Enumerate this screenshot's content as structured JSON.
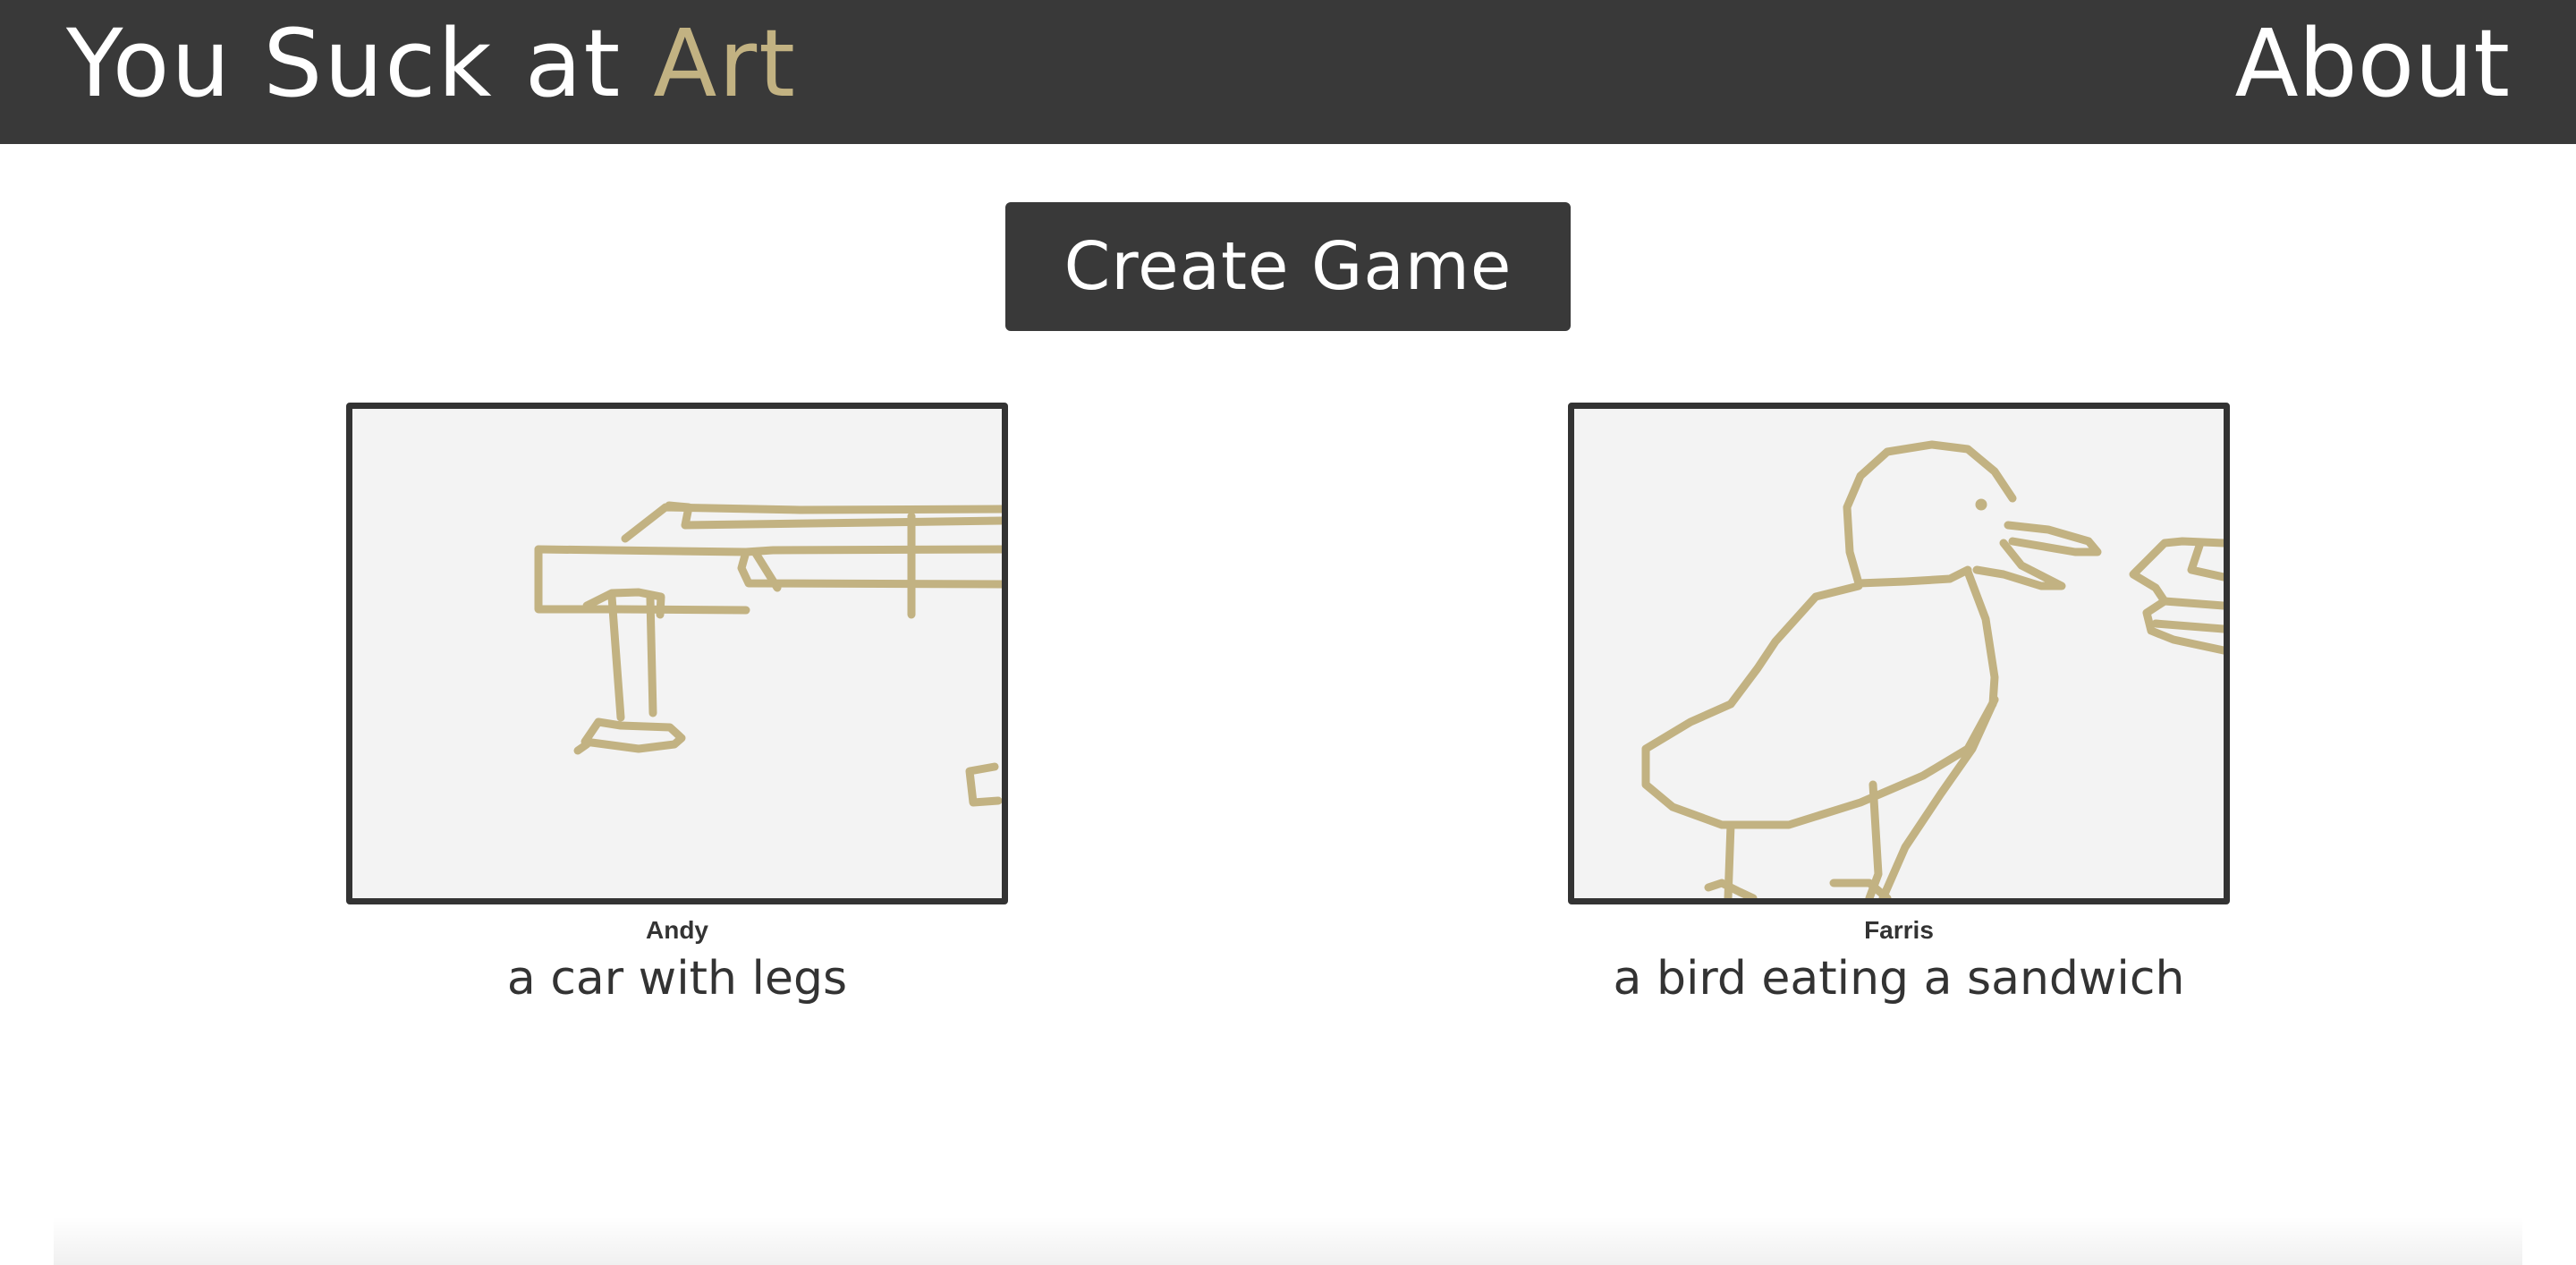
{
  "header": {
    "brand_prefix": "You Suck at ",
    "brand_accent": "Art",
    "about_label": "About"
  },
  "actions": {
    "create_game_label": "Create Game"
  },
  "colors": {
    "header_bg": "#393939",
    "accent": "#c2b282",
    "drawing_stroke": "#c2b282",
    "canvas_bg": "#f3f3f3"
  },
  "games": [
    {
      "artist": "Andy",
      "prompt": "a car with legs"
    },
    {
      "artist": "Farris",
      "prompt": "a bird eating a sandwich"
    }
  ]
}
